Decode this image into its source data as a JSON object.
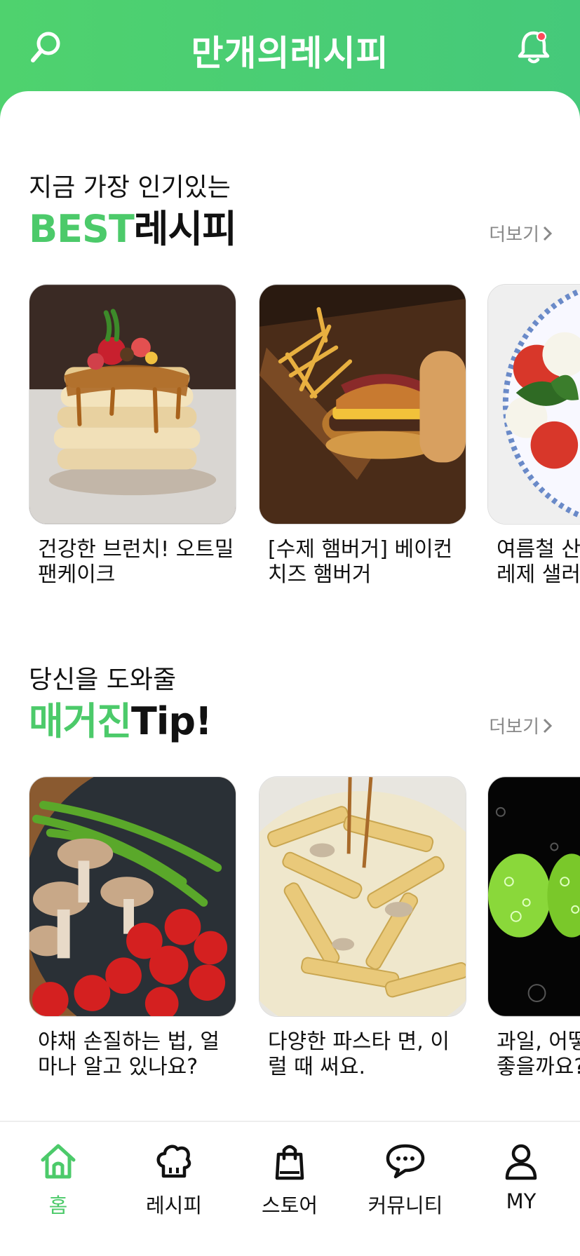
{
  "header": {
    "title": "만개의레시피",
    "search_icon": "search-icon",
    "bell_icon": "bell-icon",
    "accent": "#4fd26e"
  },
  "best": {
    "subtitle": "지금 가장 인기있는",
    "title_accent": "BEST",
    "title_rest": "레시피",
    "more": "더보기",
    "cards": [
      {
        "line1": "건강한 브런치! 오트밀",
        "line2": "팬케이크"
      },
      {
        "line1": "[수제 햄버거] 베이컨",
        "line2": "치즈 햄버거"
      },
      {
        "line1": "여름철 산뜻",
        "line2": "레제 샐러드"
      }
    ]
  },
  "magazine": {
    "subtitle": "당신을 도와줄",
    "title_accent": "매거진",
    "title_rest": "Tip!",
    "more": "더보기",
    "cards": [
      {
        "line1": "야채 손질하는 법, 얼",
        "line2": "마나 알고 있나요?"
      },
      {
        "line1": "다양한 파스타 면, 이",
        "line2": "럴 때 써요."
      },
      {
        "line1": "과일, 어떻게",
        "line2": "좋을까요?"
      }
    ]
  },
  "nav": [
    {
      "label": "홈",
      "icon": "home-icon",
      "active": true
    },
    {
      "label": "레시피",
      "icon": "chef-hat-icon",
      "active": false
    },
    {
      "label": "스토어",
      "icon": "shopping-bag-icon",
      "active": false
    },
    {
      "label": "커뮤니티",
      "icon": "chat-bubble-icon",
      "active": false
    },
    {
      "label": "MY",
      "icon": "user-icon",
      "active": false
    }
  ],
  "colors": {
    "accent": "#4cca6a",
    "muted": "#888888"
  }
}
